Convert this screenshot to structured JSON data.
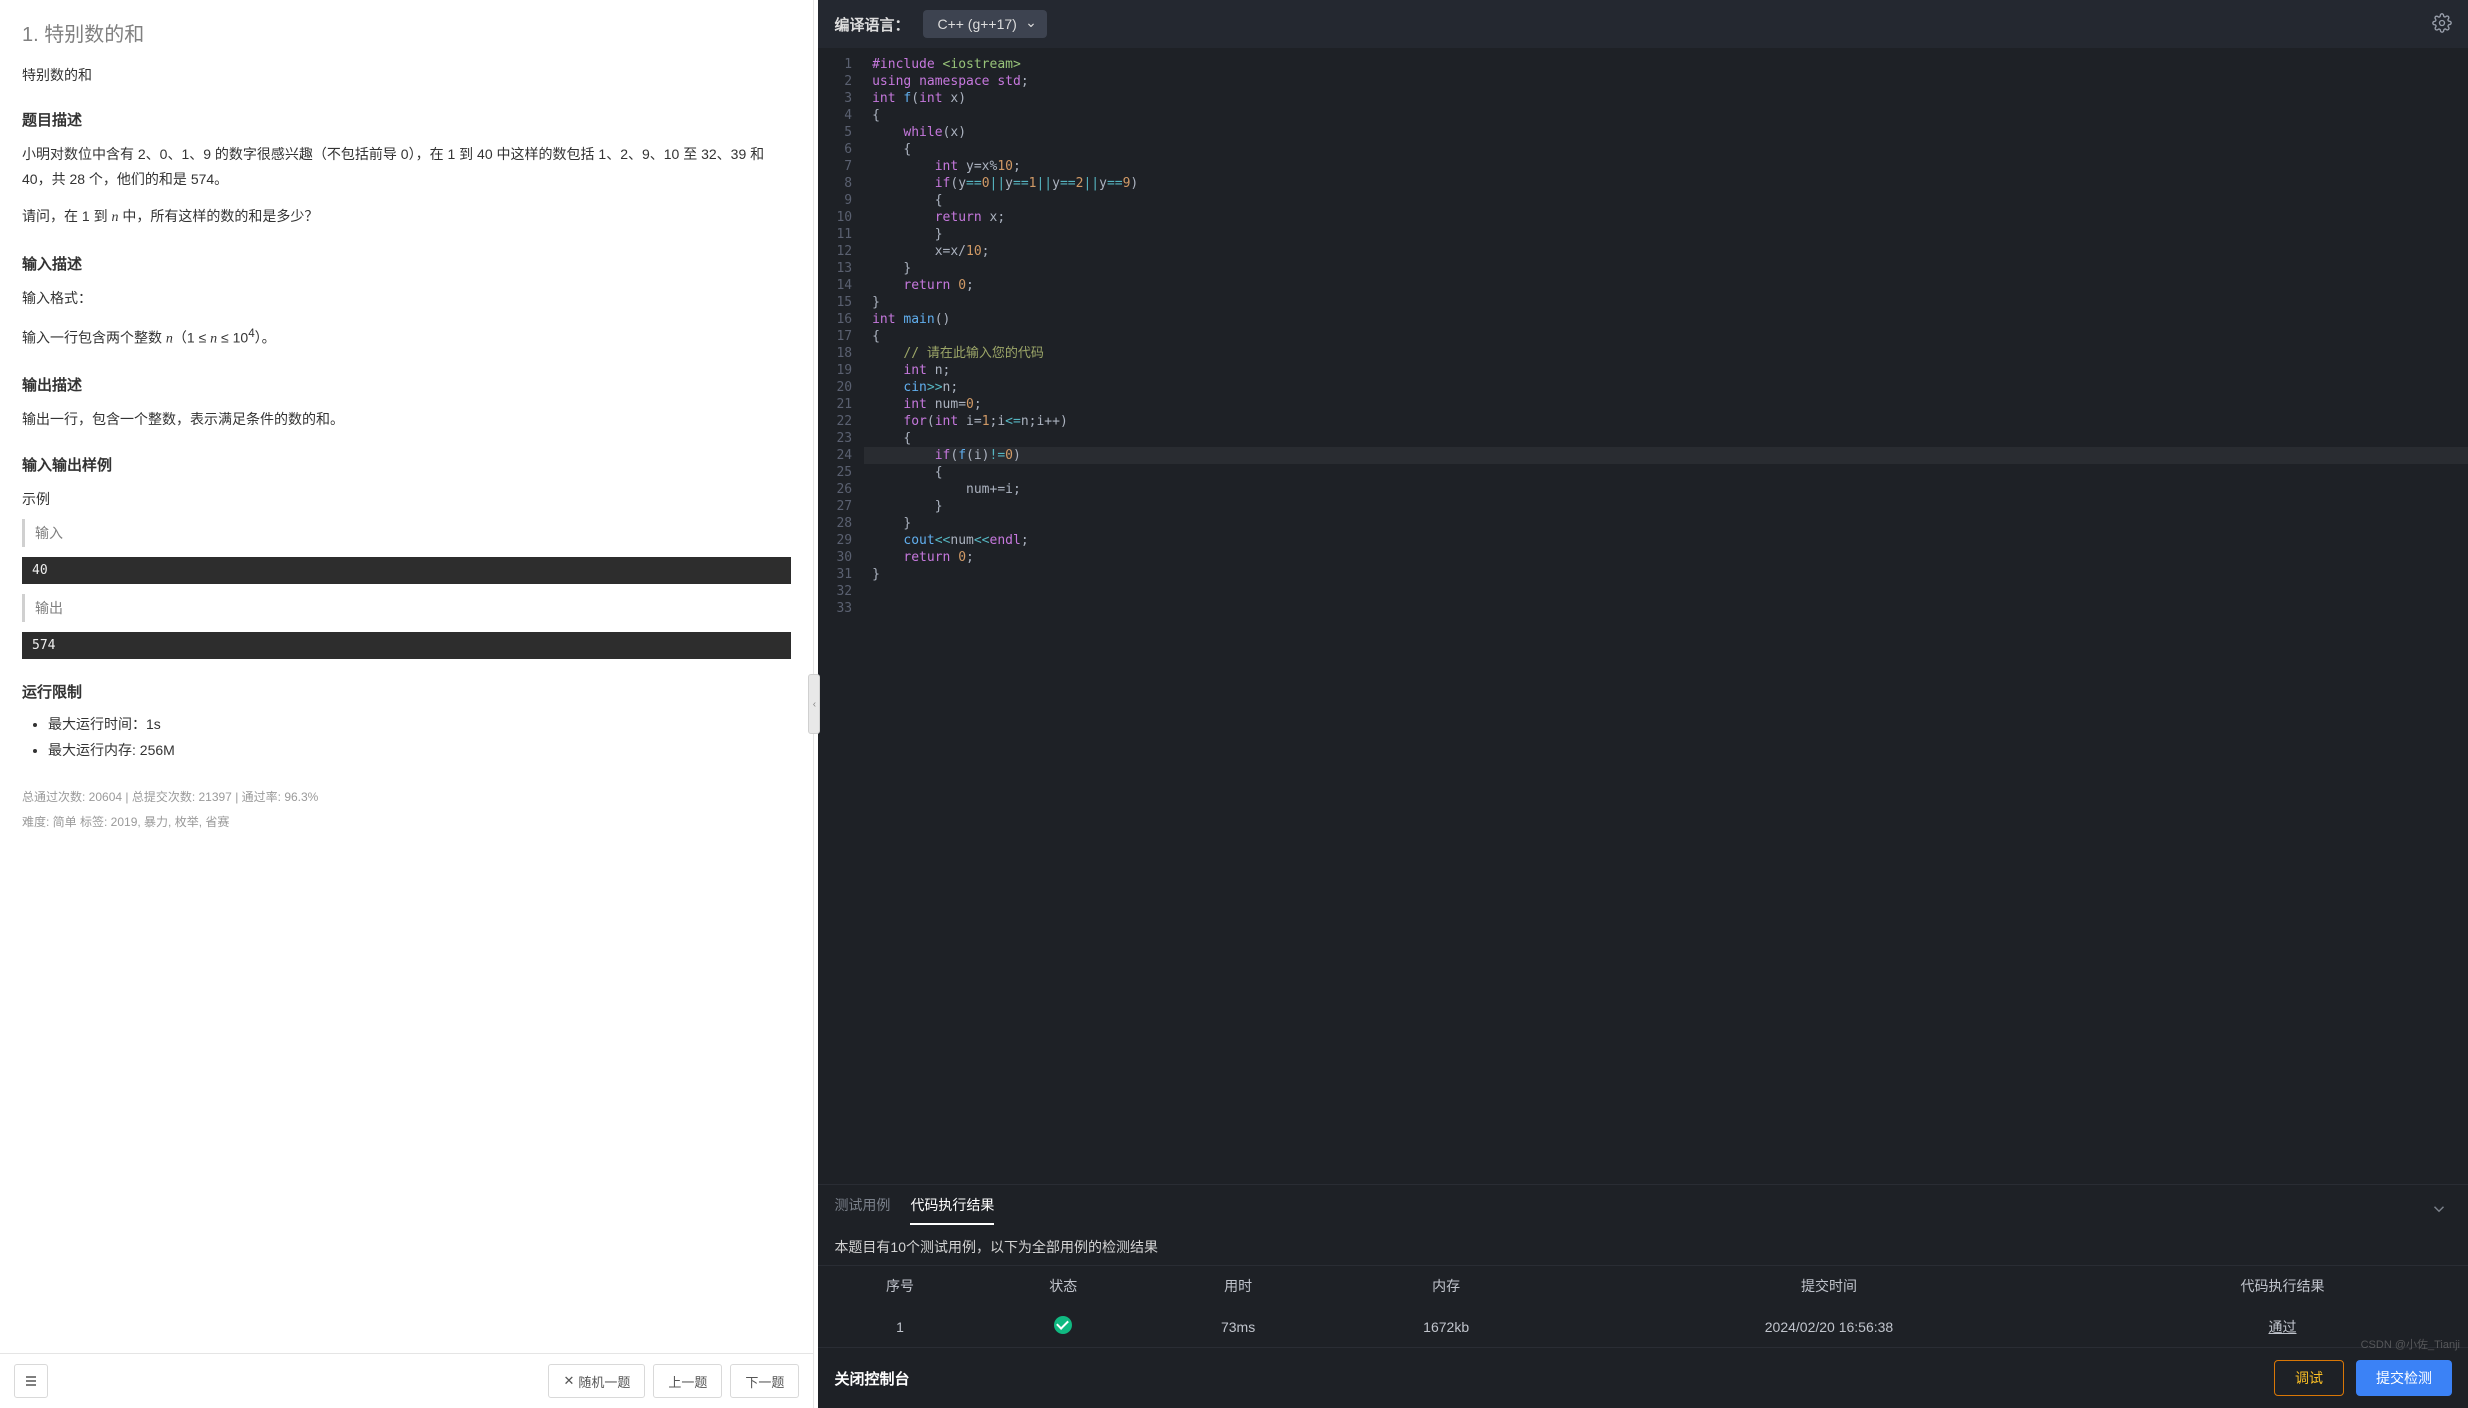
{
  "problem": {
    "title_full": "1. 特别数的和",
    "subtitle": "特别数的和",
    "headings": {
      "desc": "题目描述",
      "input": "输入描述",
      "output": "输出描述",
      "sample": "输入输出样例",
      "limits": "运行限制"
    },
    "desc_p1": "小明对数位中含有 2、0、1、9 的数字很感兴趣（不包括前导 0），在 1 到 40 中这样的数包括 1、2、9、10 至 32、39 和 40，共 28 个，他们的和是 574。",
    "desc_p2": "请问，在 1 到 n 中，所有这样的数的和是多少？",
    "input_fmt_label": "输入格式：",
    "input_fmt": "输入一行包含两个整数 n（1 ≤ n ≤ 10⁴）。",
    "output_fmt": "输出一行，包含一个整数，表示满足条件的数的和。",
    "sample_label": "示例",
    "io_input_label": "输入",
    "io_output_label": "输出",
    "sample_input": "40",
    "sample_output": "574",
    "limit_time": "最大运行时间：1s",
    "limit_mem": "最大运行内存: 256M",
    "stats_line1": "总通过次数: 20604  |  总提交次数: 21397  |  通过率: 96.3%",
    "stats_line2": "难度: 简单    标签: 2019, 暴力, 枚举, 省赛"
  },
  "footer": {
    "random": "随机一题",
    "prev": "上一题",
    "next": "下一题"
  },
  "editor": {
    "lang_label": "编译语言：",
    "lang_value": "C++ (g++17)",
    "code_lines": [
      "#include <iostream>",
      "using namespace std;",
      "",
      "int f(int x)",
      "{",
      "    while(x)",
      "    {",
      "        int y=x%10;",
      "        if(y==0||y==1||y==2||y==9)",
      "        {",
      "        return x;",
      "        }",
      "        x=x/10;",
      "    }",
      "    return 0;",
      "}",
      "int main()",
      "{",
      "    // 请在此输入您的代码",
      "    int n;",
      "    cin>>n;",
      "",
      "    int num=0;",
      "    for(int i=1;i<=n;i++)",
      "    {",
      "        if(f(i)!=0)",
      "        {",
      "            num+=i;",
      "        }",
      "    }",
      "    cout<<num<<endl;",
      "    return 0;",
      "}"
    ],
    "highlight_line": 26
  },
  "bottom": {
    "tabs": {
      "tests": "测试用例",
      "results": "代码执行结果"
    },
    "desc": "本题目有10个测试用例，以下为全部用例的检测结果",
    "cols": {
      "idx": "序号",
      "status": "状态",
      "time": "用时",
      "mem": "内存",
      "submit": "提交时间",
      "result": "代码执行结果"
    },
    "row": {
      "idx": "1",
      "time": "73ms",
      "mem": "1672kb",
      "submit": "2024/02/20 16:56:38",
      "result": "通过"
    },
    "close": "关闭控制台",
    "debug": "调试",
    "submit": "提交检测"
  },
  "watermark": "CSDN @小佐_Tianji"
}
